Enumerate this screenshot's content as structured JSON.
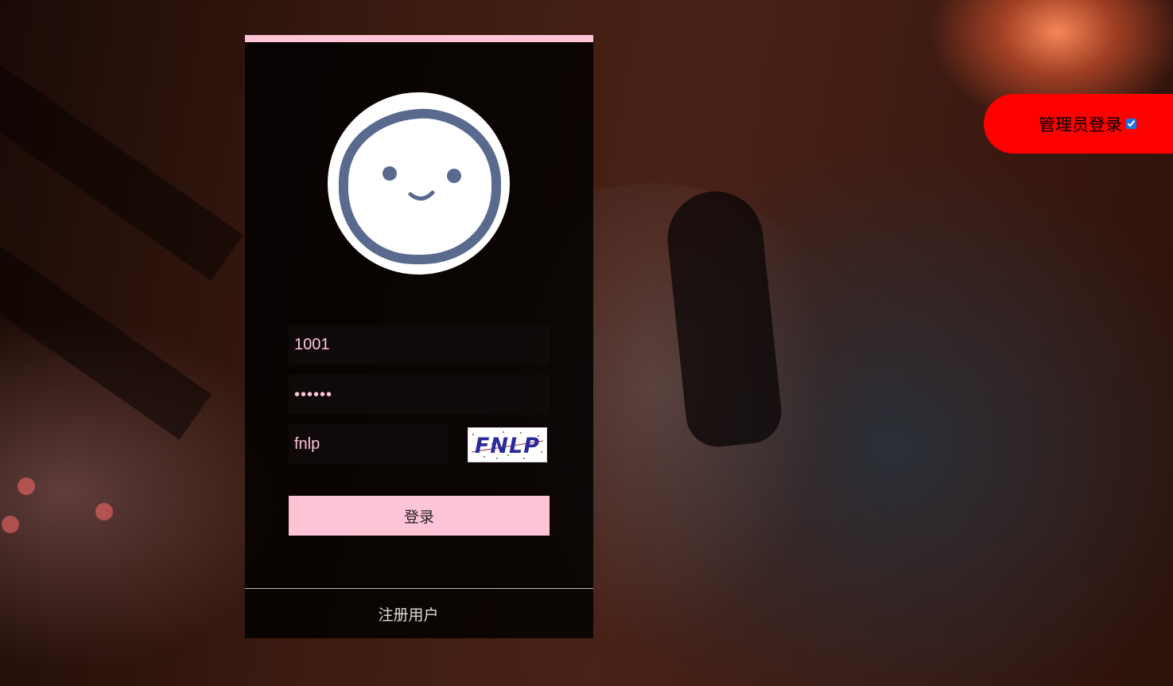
{
  "login_form": {
    "username_value": "1001",
    "password_value": "••••••",
    "captcha_value": "fnlp",
    "captcha_image_text": "FNLP",
    "login_label": "登录",
    "register_label": "注册用户"
  },
  "admin": {
    "label": "管理员登录",
    "checked": true
  },
  "colors": {
    "accent_pink": "#ffc5d7",
    "admin_red": "#ff0000"
  },
  "icons": {
    "avatar": "smiley-face-icon"
  }
}
